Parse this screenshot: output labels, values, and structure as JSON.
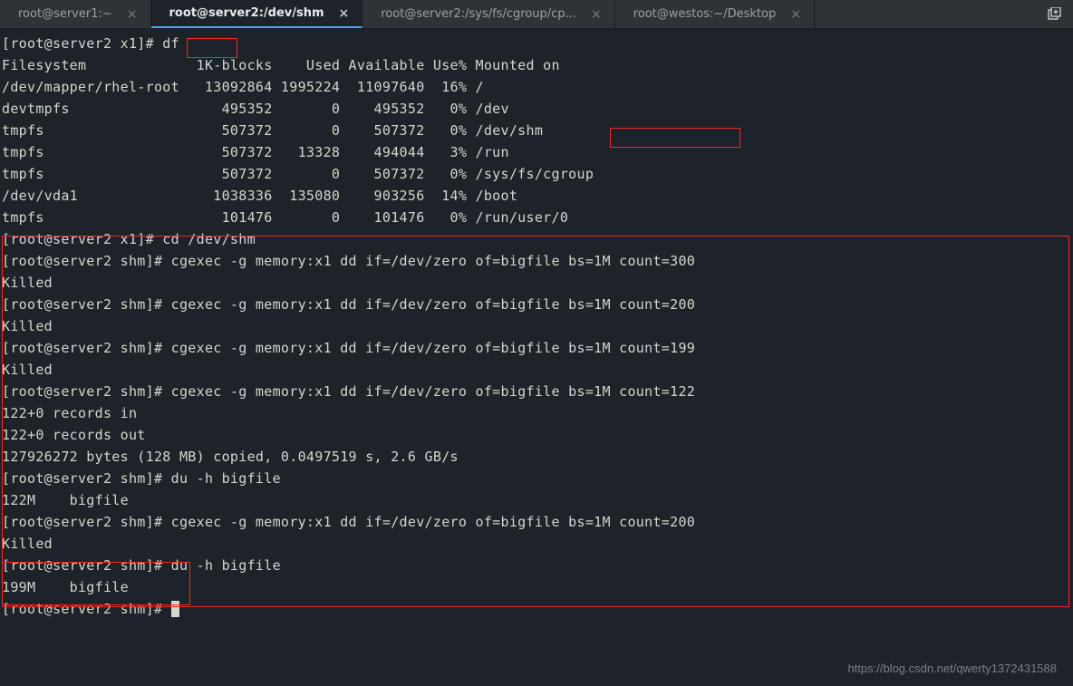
{
  "tabs": [
    {
      "title": "root@server1:~"
    },
    {
      "title": "root@server2:/dev/shm"
    },
    {
      "title": "root@server2:/sys/fs/cgroup/cp..."
    },
    {
      "title": "root@westos:~/Desktop"
    }
  ],
  "prompt1": "[root@server2 x1]# ",
  "cmd_df": "df",
  "df_header": "Filesystem             1K-blocks    Used Available Use% Mounted on",
  "df_rows": [
    "/dev/mapper/rhel-root   13092864 1995224  11097640  16% /",
    "devtmpfs                  495352       0    495352   0% /dev",
    "tmpfs                     507372       0    507372   0% ",
    "tmpfs                     507372   13328    494044   3% /run",
    "tmpfs                     507372       0    507372   0% /sys/fs/cgroup",
    "/dev/vda1                1038336  135080    903256  14% /boot",
    "tmpfs                     101476       0    101476   0% /run/user/0"
  ],
  "devshm": "/dev/shm",
  "lines": [
    "[root@server2 x1]# cd /dev/shm",
    "[root@server2 shm]# cgexec -g memory:x1 dd if=/dev/zero of=bigfile bs=1M count=300",
    "Killed",
    "[root@server2 shm]# cgexec -g memory:x1 dd if=/dev/zero of=bigfile bs=1M count=200",
    "Killed",
    "[root@server2 shm]# cgexec -g memory:x1 dd if=/dev/zero of=bigfile bs=1M count=199",
    "Killed",
    "[root@server2 shm]# cgexec -g memory:x1 dd if=/dev/zero of=bigfile bs=1M count=122",
    "122+0 records in",
    "122+0 records out",
    "127926272 bytes (128 MB) copied, 0.0497519 s, 2.6 GB/s",
    "[root@server2 shm]# du -h bigfile",
    "122M    bigfile",
    "[root@server2 shm]# cgexec -g memory:x1 dd if=/dev/zero of=bigfile bs=1M count=200",
    "Killed",
    "[root@server2 shm]# du -h bigfile",
    "199M    bigfile",
    "[root@server2 shm]# "
  ],
  "watermark": "https://blog.csdn.net/qwerty1372431588"
}
